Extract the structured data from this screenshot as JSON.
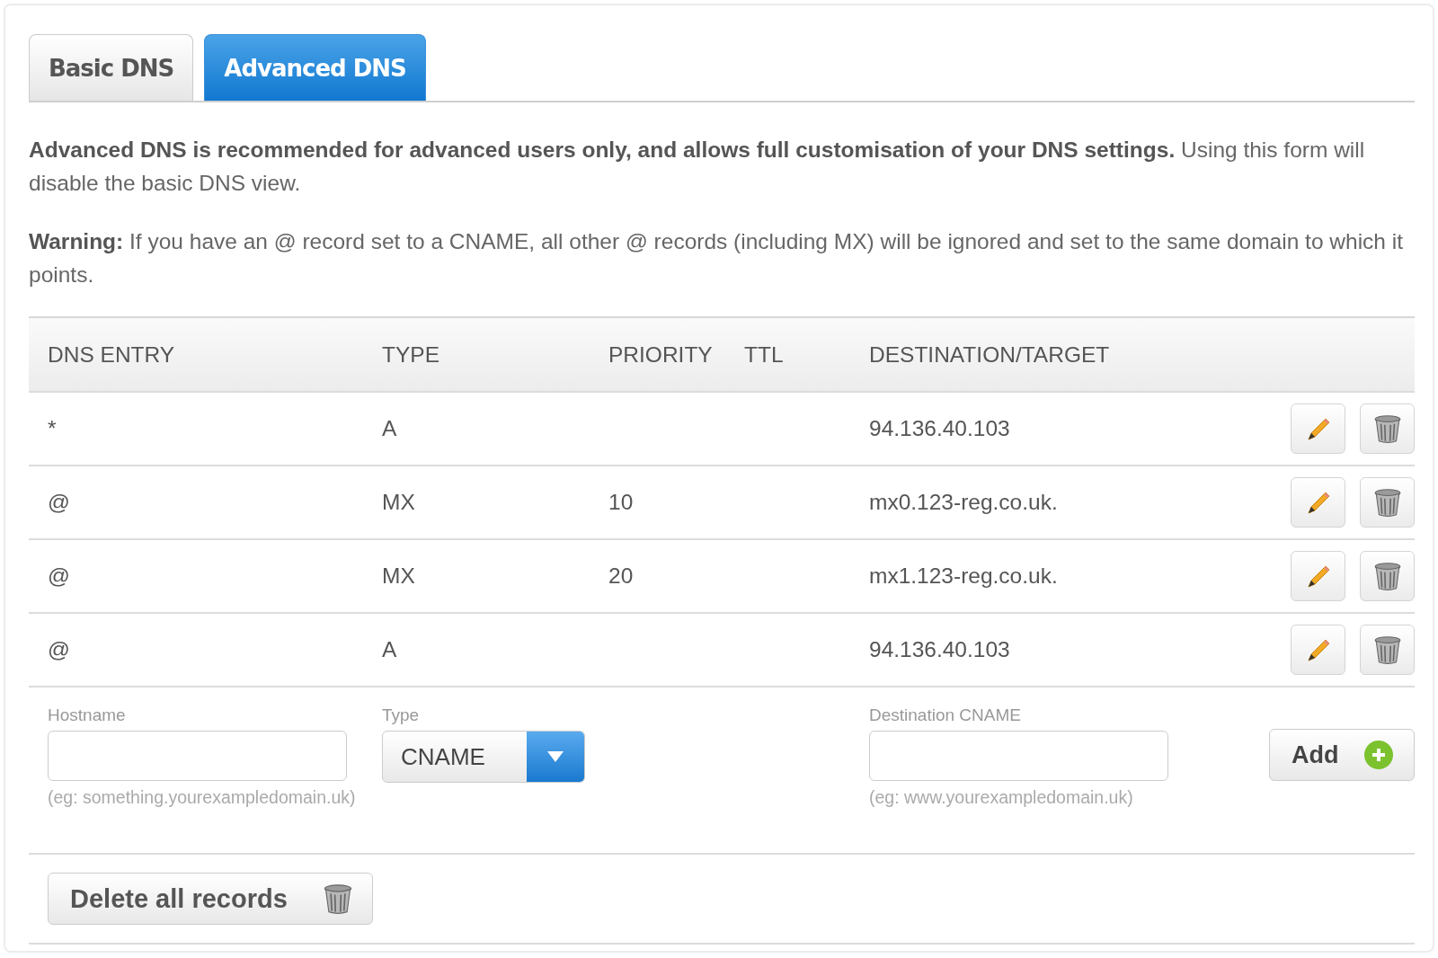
{
  "tabs": [
    {
      "label": "Basic DNS",
      "selected": false
    },
    {
      "label": "Advanced DNS",
      "selected": true
    }
  ],
  "intro": "**Advanced DNS is recommended for advanced users only, and allows full customisation of your DNS settings.** Using this form will disable the basic DNS view.",
  "warning": "**Warning:** If you have an @ record set to a CNAME, all other @ records (including MX) will be ignored and set to the same domain to which it points.",
  "table": {
    "columns": [
      "DNS ENTRY",
      "TYPE",
      "PRIORITY",
      "TTL",
      "DESTINATION/TARGET"
    ],
    "rows": [
      {
        "dns_entry": "*",
        "type": "A",
        "destination": "94.136.40.103"
      },
      {
        "dns_entry": "@",
        "type": "MX",
        "priority": "10",
        "destination": "mx0.123-reg.co.uk."
      },
      {
        "dns_entry": "@",
        "type": "MX",
        "priority": "20",
        "destination": "mx1.123-reg.co.uk."
      },
      {
        "dns_entry": "@",
        "type": "A",
        "destination": "94.136.40.103"
      }
    ]
  },
  "form": {
    "hostname": {
      "label": "Hostname",
      "hint": "(eg: something.yourexampledomain.uk)"
    },
    "type": {
      "label": "Type",
      "value": "CNAME"
    },
    "destination": {
      "label": "Destination CNAME",
      "hint": "(eg: www.yourexampledomain.uk)"
    },
    "add_button": "Add"
  },
  "delete_all_button": "Delete all records"
}
